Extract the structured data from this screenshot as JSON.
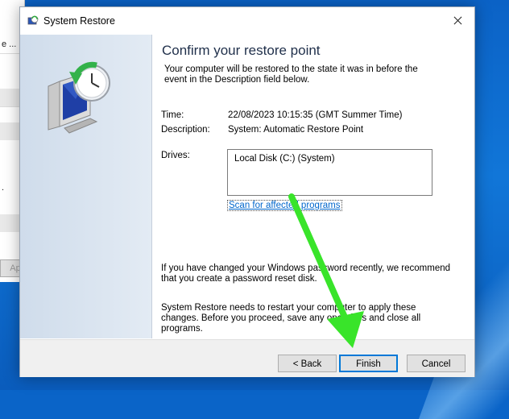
{
  "background_window": {
    "rows": [
      "e ...",
      "",
      "",
      "",
      "",
      "",
      ".",
      "",
      ""
    ],
    "apply_button": "Ap"
  },
  "dialog": {
    "title": "System Restore",
    "heading": "Confirm your restore point",
    "intro": "Your computer will be restored to the state it was in before the event in the Description field below.",
    "time_label": "Time:",
    "time_value": "22/08/2023 10:15:35 (GMT Summer Time)",
    "description_label": "Description:",
    "description_value": "System: Automatic Restore Point",
    "drives_label": "Drives:",
    "drives": [
      "Local Disk (C:) (System)"
    ],
    "scan_link": "Scan for affected programs",
    "password_note": "If you have changed your Windows password recently, we recommend that you create a password reset disk.",
    "restart_note": "System Restore needs to restart your computer to apply these changes. Before you proceed, save any open files and close all programs.",
    "buttons": {
      "back": "< Back",
      "finish": "Finish",
      "cancel": "Cancel"
    }
  },
  "colors": {
    "accent": "#0078d7",
    "link": "#0066cc",
    "annotation_arrow": "#39e42a"
  },
  "icons": {
    "title": "system-restore-icon",
    "illustration": "monitor-clock-restore-icon",
    "close": "close-icon"
  }
}
